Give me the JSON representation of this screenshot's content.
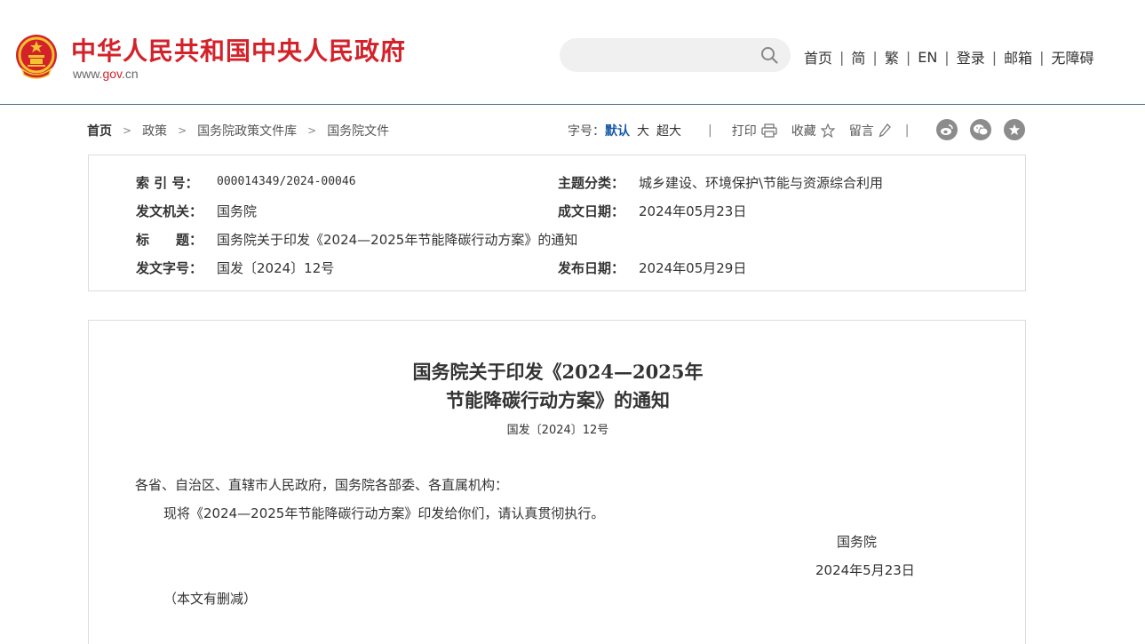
{
  "header": {
    "site_title": "中华人民共和国中央人民政府",
    "domain_prefix": "www.",
    "domain_gov": "gov",
    "domain_suffix": ".cn",
    "search_placeholder": "",
    "nav": [
      "首页",
      "简",
      "繁",
      "EN",
      "登录",
      "邮箱",
      "无障碍"
    ]
  },
  "breadcrumb": [
    "首页",
    "政策",
    "国务院政策文件库",
    "国务院文件"
  ],
  "tools": {
    "font_label": "字号：",
    "font_default": "默认",
    "font_large": "大",
    "font_xlarge": "超大",
    "print": "打印",
    "favorite": "收藏",
    "comment": "留言",
    "share_icons": [
      "weibo-icon",
      "wechat-icon",
      "star-icon"
    ]
  },
  "info": {
    "index_label": "索 引 号：",
    "index_value": "000014349/2024-00046",
    "topic_label": "主题分类：",
    "topic_value": "城乡建设、环境保护\\节能与资源综合利用",
    "issuer_label": "发文机关：",
    "issuer_value": "国务院",
    "date_written_label": "成文日期：",
    "date_written_value": "2024年05月23日",
    "title_label": "标　　题：",
    "title_value": "国务院关于印发《2024—2025年节能降碳行动方案》的通知",
    "doc_no_label": "发文字号：",
    "doc_no_value": "国发〔2024〕12号",
    "publish_label": "发布日期：",
    "publish_value": "2024年05月29日"
  },
  "article": {
    "title_line1": "国务院关于印发《2024—2025年",
    "title_line2": "节能降碳行动方案》的通知",
    "doc_no": "国发〔2024〕12号",
    "salutation": "各省、自治区、直辖市人民政府，国务院各部委、各直属机构：",
    "body": "现将《2024—2025年节能降碳行动方案》印发给你们，请认真贯彻执行。",
    "signer": "国务院",
    "sign_date": "2024年5月23日",
    "note": "（本文有删减）"
  },
  "colors": {
    "brand_red": "#d3222a",
    "accent_blue": "#1a5aa8",
    "header_border": "#4a6a8f"
  }
}
